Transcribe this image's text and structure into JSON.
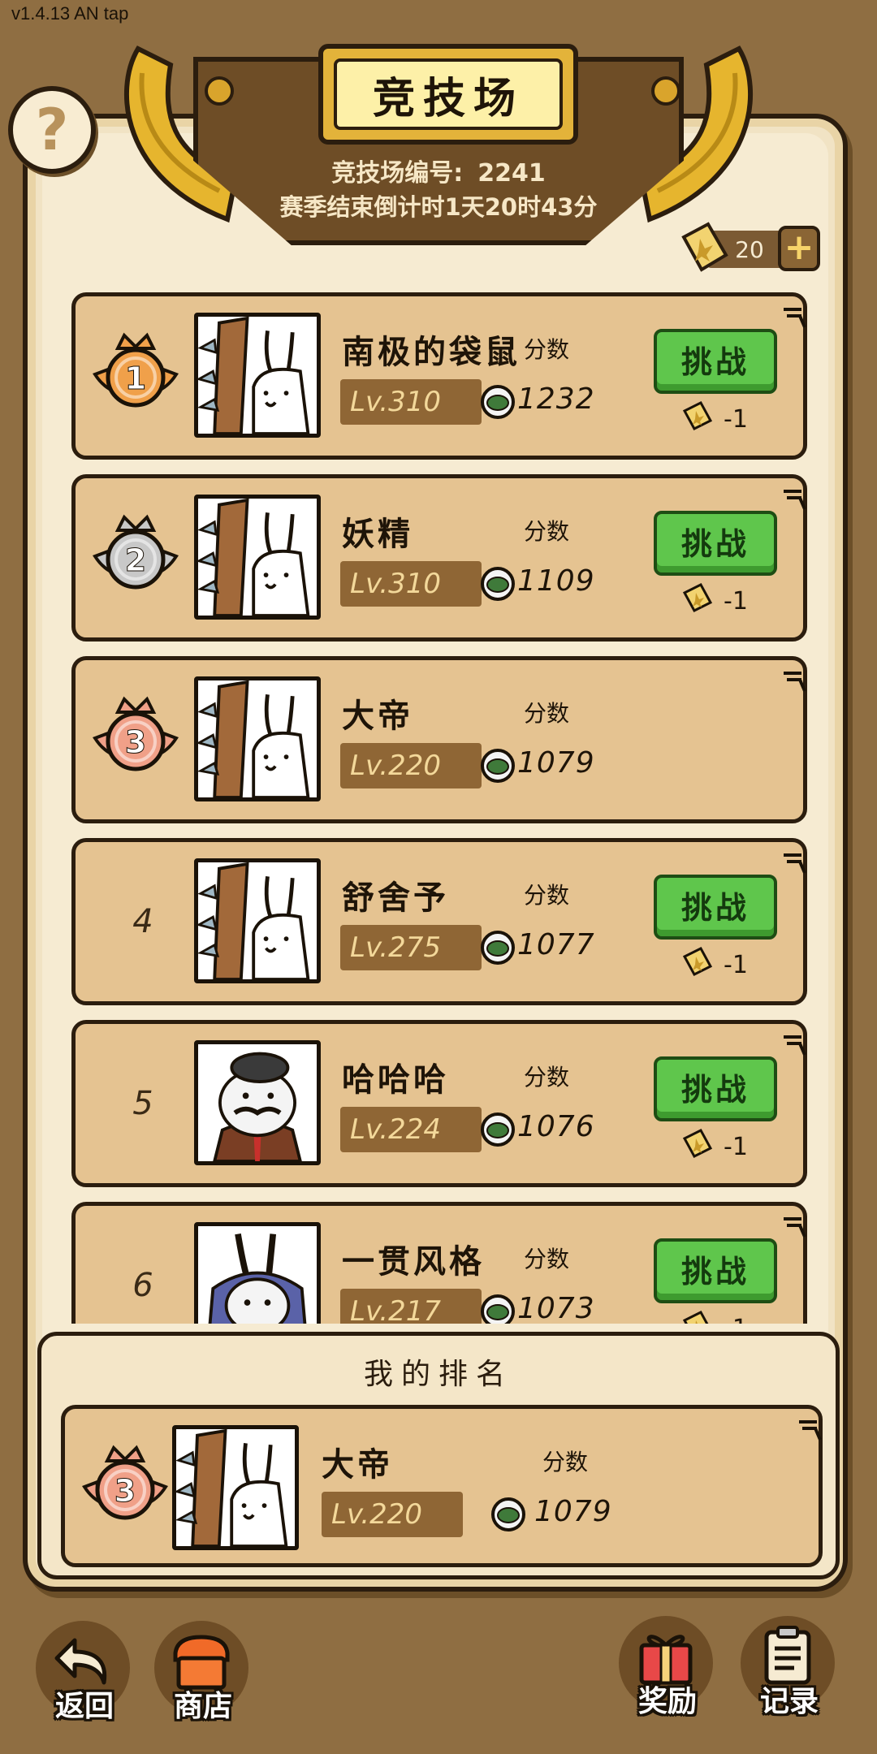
{
  "version": "v1.4.13 AN tap",
  "header": {
    "title": "竞技场",
    "arena_id_label": "竞技场编号:",
    "arena_id": "2241",
    "countdown": "赛季结束倒计时1天20时43分"
  },
  "help_label": "?",
  "tickets": {
    "count": "20",
    "add_label": "+"
  },
  "score_label": "分数",
  "challenge_label": "挑战",
  "challenge_cost": "-1",
  "rows": [
    {
      "rank": "1",
      "name": "南极的袋鼠",
      "level": "Lv.310",
      "score": "1232",
      "avatar": "rabbit-bat",
      "medal_color": "#f0a04a",
      "has_challenge": true
    },
    {
      "rank": "2",
      "name": "妖精",
      "level": "Lv.310",
      "score": "1109",
      "avatar": "rabbit-bat",
      "medal_color": "#c8c8c8",
      "has_challenge": true
    },
    {
      "rank": "3",
      "name": "大帝",
      "level": "Lv.220",
      "score": "1079",
      "avatar": "rabbit-bat",
      "medal_color": "#f0a088",
      "has_challenge": false
    },
    {
      "rank": "4",
      "name": "舒舍予",
      "level": "Lv.275",
      "score": "1077",
      "avatar": "rabbit-bat",
      "medal_color": "",
      "has_challenge": true
    },
    {
      "rank": "5",
      "name": "哈哈哈",
      "level": "Lv.224",
      "score": "1076",
      "avatar": "gentleman",
      "medal_color": "",
      "has_challenge": true
    },
    {
      "rank": "6",
      "name": "一贯风格",
      "level": "Lv.217",
      "score": "1073",
      "avatar": "knight-rabbit",
      "medal_color": "",
      "has_challenge": true
    }
  ],
  "my_rank": {
    "title": "我的排名",
    "rank": "3",
    "name": "大帝",
    "level": "Lv.220",
    "score": "1079",
    "medal_color": "#f0a088"
  },
  "nav": {
    "back": "返回",
    "shop": "商店",
    "rewards": "奖励",
    "records": "记录"
  }
}
